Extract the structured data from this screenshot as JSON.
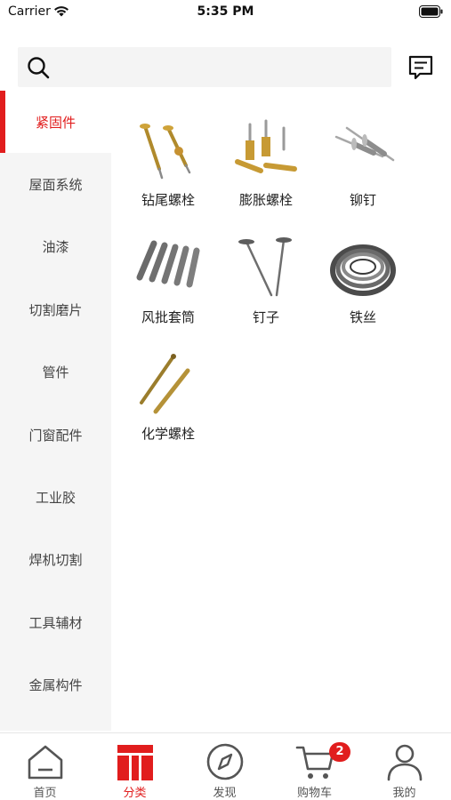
{
  "status_bar": {
    "carrier": "Carrier",
    "time": "5:35 PM"
  },
  "header": {
    "search_placeholder": ""
  },
  "sidebar": {
    "items": [
      {
        "label": "紧固件",
        "active": true
      },
      {
        "label": "屋面系统"
      },
      {
        "label": "油漆"
      },
      {
        "label": "切割磨片"
      },
      {
        "label": "管件"
      },
      {
        "label": "门窗配件"
      },
      {
        "label": "工业胶"
      },
      {
        "label": "焊机切割"
      },
      {
        "label": "工具辅材"
      },
      {
        "label": "金属构件"
      }
    ]
  },
  "products": [
    {
      "name": "钻尾螺栓",
      "icon": "self-drilling-screw-image"
    },
    {
      "name": "膨胀螺栓",
      "icon": "expansion-bolt-image"
    },
    {
      "name": "铆钉",
      "icon": "rivet-image"
    },
    {
      "name": "风批套筒",
      "icon": "socket-bit-image"
    },
    {
      "name": "钉子",
      "icon": "nail-image"
    },
    {
      "name": "铁丝",
      "icon": "wire-coil-image"
    },
    {
      "name": "化学螺栓",
      "icon": "chemical-anchor-image"
    }
  ],
  "tabbar": {
    "tabs": [
      {
        "label": "首页",
        "icon": "home-icon"
      },
      {
        "label": "分类",
        "icon": "category-icon",
        "active": true
      },
      {
        "label": "发现",
        "icon": "compass-icon"
      },
      {
        "label": "购物车",
        "icon": "cart-icon",
        "badge": "2"
      },
      {
        "label": "我的",
        "icon": "profile-icon"
      }
    ]
  },
  "colors": {
    "accent": "#e11d1d",
    "sidebar_bg": "#f5f5f5",
    "search_bg": "#f4f4f4"
  }
}
